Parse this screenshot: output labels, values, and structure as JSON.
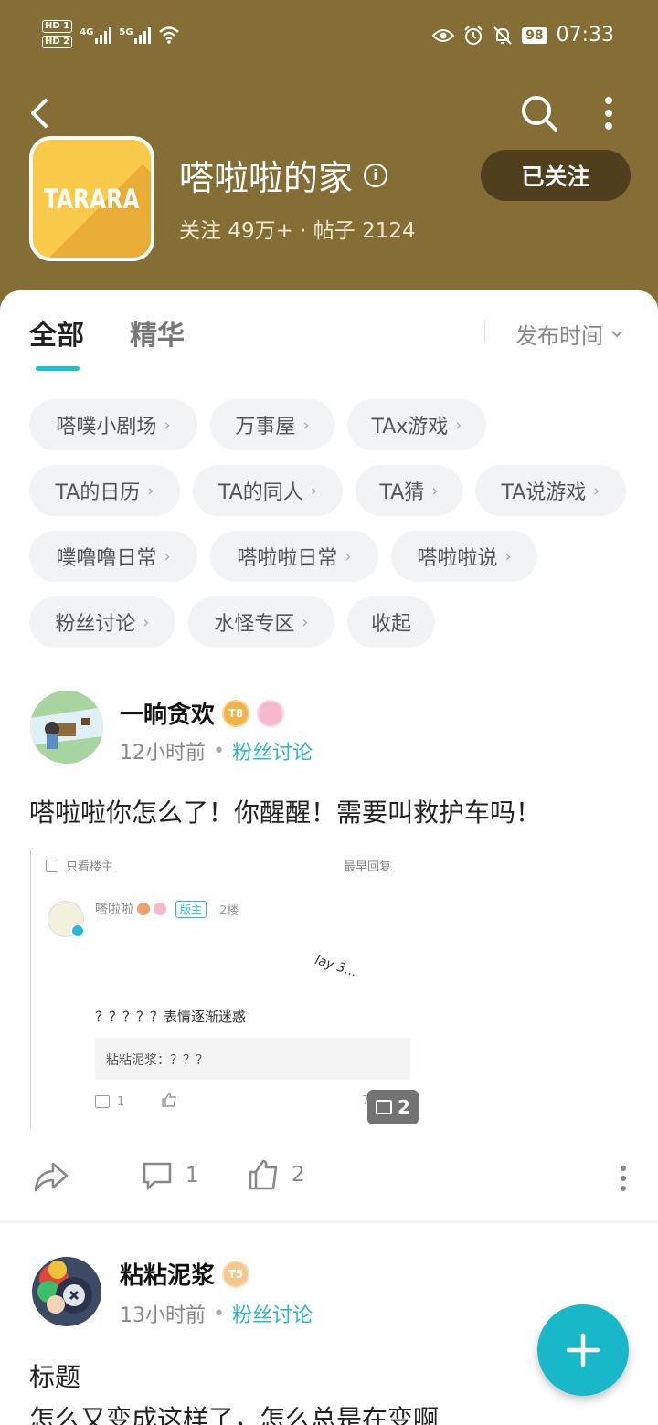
{
  "status_bar": {
    "hd1": "HD 1",
    "hd2": "HD 2",
    "net1": "4G",
    "net2": "5G",
    "battery": "98",
    "time": "07:33"
  },
  "header": {
    "logo_text": "TARARA",
    "title": "嗒啦啦的家",
    "stats": "关注 49万+ · 帖子 2124",
    "follow_label": "已关注",
    "background_color": "#856d36"
  },
  "tabs": [
    {
      "label": "全部",
      "active": true
    },
    {
      "label": "精华",
      "active": false
    }
  ],
  "sort": {
    "label": "发布时间"
  },
  "chips": [
    {
      "label": "嗒噗小剧场",
      "chevron": true
    },
    {
      "label": "万事屋",
      "chevron": true
    },
    {
      "label": "TAx游戏",
      "chevron": true
    },
    {
      "label": "TA的日历",
      "chevron": true
    },
    {
      "label": "TA的同人",
      "chevron": true
    },
    {
      "label": "TA猜",
      "chevron": true
    },
    {
      "label": "TA说游戏",
      "chevron": true
    },
    {
      "label": "噗噜噜日常",
      "chevron": true
    },
    {
      "label": "嗒啦啦日常",
      "chevron": true
    },
    {
      "label": "嗒啦啦说",
      "chevron": true
    },
    {
      "label": "粉丝讨论",
      "chevron": true
    },
    {
      "label": "水怪专区",
      "chevron": true
    },
    {
      "label": "收起",
      "chevron": false
    }
  ],
  "posts": [
    {
      "author": "一晌贪欢",
      "level_badge": "T8",
      "time": "12小时前",
      "category": "粉丝讨论",
      "text": "嗒啦啦你怎么了！你醒醒！需要叫救护车吗！",
      "image_count": "2",
      "screenshot": {
        "filter_label": "只看楼主",
        "sort_label": "最早回复",
        "name": "嗒啦啦",
        "mod_tag": "版主",
        "floor": "2楼",
        "doodle": "lay 3...",
        "body": "？？？？？表情逐渐迷惑",
        "quote": "粘粘泥浆：？？？",
        "comment_count": "1",
        "time_partial": "7"
      },
      "comments": "1",
      "likes": "2"
    },
    {
      "author": "粘粘泥浆",
      "level_badge": "T5",
      "time": "13小时前",
      "category": "粉丝讨论",
      "text_line1": "标题",
      "text_line2": "怎么又变成这样了，怎么总是在变啊"
    }
  ],
  "colors": {
    "accent": "#15c5ce",
    "category_text": "#2cb8c2",
    "fab": "#19b8c9",
    "follow_button": "#4f3f1c"
  }
}
